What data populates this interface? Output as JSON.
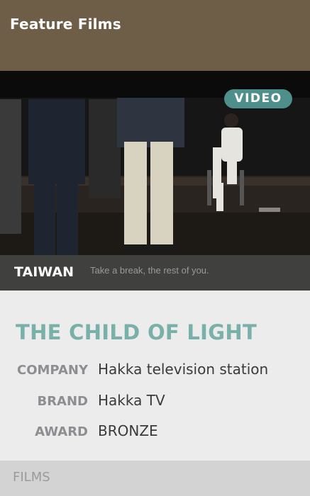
{
  "header": {
    "title": "Feature Films",
    "background": "#6e5e48"
  },
  "video": {
    "badge": "VIDEO",
    "badge_color": "#4e8f8c",
    "country": "TAIWAN",
    "subtitle": "Take a break, the rest of you."
  },
  "film": {
    "title": "THE CHILD OF LIGHT",
    "title_color": "#79b0a9",
    "details": [
      {
        "label": "COMPANY",
        "value": "Hakka television station"
      },
      {
        "label": "BRAND",
        "value": "Hakka TV"
      },
      {
        "label": "AWARD",
        "value": "BRONZE"
      }
    ]
  },
  "footer": {
    "label": "FILMS"
  }
}
